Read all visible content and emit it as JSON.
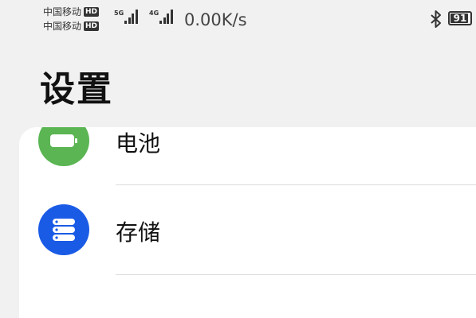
{
  "status_bar": {
    "carrier1": "中国移动",
    "carrier2": "中国移动",
    "hd": "HD",
    "signal1_gen": "5G",
    "signal2_gen": "4G",
    "net_speed": "0.00K/s",
    "battery_level": "91",
    "battery_fraction": 0.91
  },
  "header": {
    "title": "设置"
  },
  "settings": {
    "items": [
      {
        "label": "电池",
        "icon": "battery-icon",
        "icon_bg": "#5ab552"
      },
      {
        "label": "存储",
        "icon": "storage-icon",
        "icon_bg": "#1a5be6"
      }
    ]
  }
}
